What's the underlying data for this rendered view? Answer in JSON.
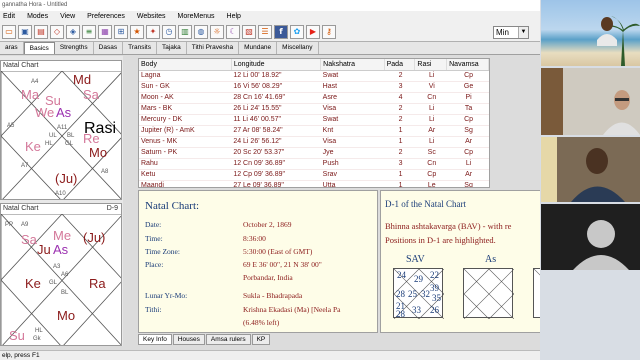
{
  "window": {
    "title": "gannatha Hora - Untitled"
  },
  "menu": [
    "Edit",
    "Modes",
    "View",
    "Preferences",
    "Websites",
    "MoreMenus",
    "Help"
  ],
  "toolbar": {
    "icons": [
      "folder-icon",
      "save-icon",
      "print-icon",
      "chart-icon",
      "divisional-icon",
      "dasa-icon",
      "calc-icon",
      "grid-icon",
      "star-icon",
      "compass-icon",
      "clock-icon",
      "books-icon",
      "globe-icon",
      "sun-icon",
      "moon-icon",
      "table-icon",
      "panchang-icon",
      "facebook-icon",
      "twitter-icon",
      "youtube-icon",
      "key-icon"
    ],
    "select_value": "Min"
  },
  "tabs": [
    "aras",
    "Basics",
    "Strengths",
    "Dasas",
    "Transits",
    "Tajaka",
    "Tithi Pravesha",
    "Mundane",
    "Miscellany"
  ],
  "active_tab": "Basics",
  "charts": {
    "top": {
      "caption": "Natal Chart",
      "label": "Rasi",
      "planets": [
        {
          "t": "Md"
        },
        {
          "t": "Ma"
        },
        {
          "t": "Sa"
        },
        {
          "t": "Su"
        },
        {
          "t": "We"
        },
        {
          "t": "As"
        },
        {
          "t": "Ke"
        },
        {
          "t": "Re"
        },
        {
          "t": "Mo"
        },
        {
          "t": "(Ju)"
        }
      ],
      "small": [
        "A11",
        "UL",
        "BL",
        "HL",
        "GL",
        "A7",
        "A4",
        "A10",
        "A5",
        "A8"
      ]
    },
    "bottom": {
      "caption": "Natal Chart",
      "label": "D-9",
      "planets": [
        {
          "t": "Sa"
        },
        {
          "t": "Me"
        },
        {
          "t": "As"
        },
        {
          "t": "Ju"
        },
        {
          "t": "Ke"
        },
        {
          "t": "Ra"
        },
        {
          "t": "(Ju)"
        },
        {
          "t": "Mo"
        },
        {
          "t": "Su"
        }
      ],
      "small": [
        "PP",
        "A9",
        "A3",
        "A6",
        "GL",
        "BL",
        "HL",
        "Gk"
      ]
    }
  },
  "table": {
    "headers": [
      "Body",
      "Longitude",
      "Nakshatra",
      "Pada",
      "Rasi",
      "Navamsa"
    ],
    "rows": [
      [
        "Lagna",
        "12 Li 00' 18.92\"",
        "Swat",
        "2",
        "Li",
        "Cp"
      ],
      [
        "Sun - GK",
        "16 Vi 56' 08.29\"",
        "Hast",
        "3",
        "Vi",
        "Ge"
      ],
      [
        "Moon - AK",
        "28 Cn 16' 41.69\"",
        "Asre",
        "4",
        "Cn",
        "Pi"
      ],
      [
        "Mars - BK",
        "26 Li 24' 15.55\"",
        "Visa",
        "2",
        "Li",
        "Ta"
      ],
      [
        "Mercury - DK",
        "11 Li 46' 00.57\"",
        "Swat",
        "2",
        "Li",
        "Cp"
      ],
      [
        "Jupiter (R) - AmK",
        "27 Ar 08' 58.24\"",
        "Knt",
        "1",
        "Ar",
        "Sg"
      ],
      [
        "Venus - MK",
        "24 Li 26' 56.12\"",
        "Visa",
        "1",
        "Li",
        "Ar"
      ],
      [
        "Saturn - PK",
        "20 Sc 20' 53.37\"",
        "Jye",
        "2",
        "Sc",
        "Cp"
      ],
      [
        "Rahu",
        "12 Cn 09' 36.89\"",
        "Push",
        "3",
        "Cn",
        "Li"
      ],
      [
        "Ketu",
        "12 Cp 09' 36.89\"",
        "Srav",
        "1",
        "Cp",
        "Ar"
      ],
      [
        "Maandi",
        "27 Le 09' 36.89\"",
        "Utta",
        "1",
        "Le",
        "Sg"
      ]
    ]
  },
  "info": {
    "title": "Natal Chart:",
    "fields": [
      {
        "label": "Date:",
        "value": "October 2, 1869"
      },
      {
        "label": "Time:",
        "value": "8:36:00"
      },
      {
        "label": "Time Zone:",
        "value": "5:30:00 (East of GMT)"
      },
      {
        "label": "Place:",
        "value": "69 E 36' 00\", 21 N 38' 00\""
      },
      {
        "label": "",
        "value": "Porbandar, India"
      },
      {
        "label": "Lunar Yr-Mo:",
        "value": "Sukla - Bhadrapada"
      },
      {
        "label": "Tithi:",
        "value": "Krishna Ekadasi (Ma) [Neela Pa"
      },
      {
        "label": "",
        "value": "(6.48% left)"
      }
    ]
  },
  "right_info": {
    "title": "D-1 of the Natal Chart",
    "line1": "Bhinna ashtakavarga (BAV) - with re",
    "line2": "Positions in D-1 are highlighted.",
    "labels": [
      "SAV",
      "As"
    ],
    "sav": [
      "24",
      "29",
      "22",
      "39",
      "28",
      "25",
      "32",
      "35",
      "21",
      "33",
      "26",
      "28"
    ]
  },
  "bottom_tabs": [
    "Key Info",
    "Houses",
    "Amsa rulers",
    "KP"
  ],
  "active_bottom_tab": "Key Info",
  "status": "elp, press F1"
}
